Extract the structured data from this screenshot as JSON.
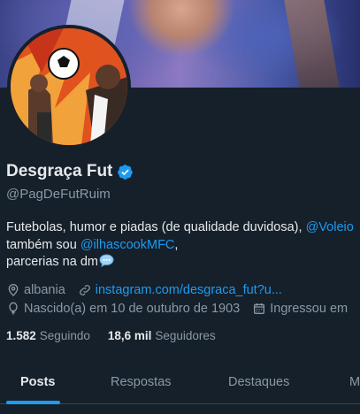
{
  "profile": {
    "display_name": "Desgraça Fut",
    "handle": "@PagDeFutRuim",
    "bio": {
      "line1_text": "Futebolas, humor e piadas (de qualidade duvidosa), ",
      "line1_mention": "@Voleio",
      "line2_text": "também sou ",
      "line2_mention": "@ilhascookMFC",
      "line2_suffix": ",",
      "line3_text": "parcerias na dm"
    },
    "location": "albania",
    "website": "instagram.com/desgraca_fut?u...",
    "birth": "Nascido(a) em 10 de outubro de 1903",
    "joined": "Ingressou em"
  },
  "stats": {
    "following_count": "1.582",
    "following_label": "Seguindo",
    "followers_count": "18,6 mil",
    "followers_label": "Seguidores"
  },
  "tabs": [
    {
      "label": "Posts",
      "active": true
    },
    {
      "label": "Respostas",
      "active": false
    },
    {
      "label": "Destaques",
      "active": false
    },
    {
      "label": "M",
      "active": false
    }
  ],
  "colors": {
    "background": "#15202b",
    "accent": "#1d9bf0",
    "secondary_text": "#8b98a5"
  },
  "icons": [
    "verified-badge-icon",
    "location-pin-icon",
    "link-icon",
    "balloon-icon",
    "calendar-icon",
    "speech-bubble-emoji-icon"
  ]
}
